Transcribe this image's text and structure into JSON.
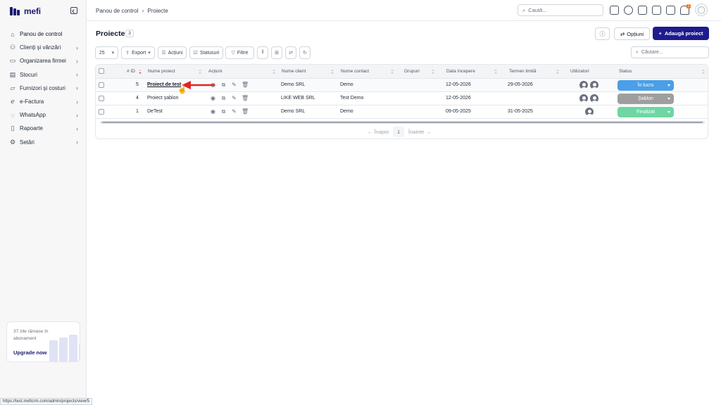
{
  "brand": {
    "name": "mefi"
  },
  "sidebar": {
    "items": [
      {
        "label": "Panou de control",
        "icon": "home-icon",
        "has_children": false
      },
      {
        "label": "Clienți și vânzări",
        "icon": "users-icon",
        "has_children": true
      },
      {
        "label": "Organizarea firmei",
        "icon": "briefcase-icon",
        "has_children": true
      },
      {
        "label": "Stocuri",
        "icon": "archive-icon",
        "has_children": true
      },
      {
        "label": "Furnizori și costuri",
        "icon": "folder-icon",
        "has_children": true
      },
      {
        "label": "e-Factura",
        "icon": "efactura-icon",
        "has_children": true
      },
      {
        "label": "WhatsApp",
        "icon": "chat-icon",
        "has_children": true
      },
      {
        "label": "Rapoarte",
        "icon": "clipboard-icon",
        "has_children": true
      },
      {
        "label": "Setări",
        "icon": "gear-icon",
        "has_children": true
      }
    ],
    "upgrade": {
      "text": "37 zile rămase în abonament",
      "cta": "Upgrade now"
    }
  },
  "topbar": {
    "breadcrumb": [
      "Panou de control",
      "Proiecte"
    ],
    "search_placeholder": "Caută...",
    "notification_count": "1"
  },
  "page": {
    "title": "Proiecte",
    "count": "3",
    "options_label": "Opțiuni",
    "add_label": "Adaugă proiect"
  },
  "toolbar": {
    "page_size": "25",
    "export_label": "Export",
    "actions_label": "Acțiuni",
    "statuses_label": "Statusuri",
    "filters_label": "Filtre",
    "search_placeholder": "Căutare..."
  },
  "table": {
    "columns": [
      "# ID",
      "Nume proiect",
      "Acțiuni",
      "Nume client",
      "Nume contact",
      "Grupuri",
      "Data începere",
      "Termen limită",
      "Utilizatori",
      "Status"
    ],
    "rows": [
      {
        "id": "5",
        "name": "Proiect de test",
        "client": "Demo SRL",
        "contact": "Demo",
        "groups": "",
        "start": "12-05-2026",
        "deadline": "29-05-2026",
        "users": 2,
        "status": "În lucru",
        "status_color": "#4a9fe8"
      },
      {
        "id": "4",
        "name": "Proiect șablon",
        "client": "LIKE WEB SRL",
        "contact": "Test Demo",
        "groups": "",
        "start": "12-05-2026",
        "deadline": "",
        "users": 2,
        "status": "Șablon",
        "status_color": "#9e9e9e"
      },
      {
        "id": "1",
        "name": "DeTest",
        "client": "Demo SRL",
        "contact": "Demo",
        "groups": "",
        "start": "09-05-2025",
        "deadline": "31-05-2025",
        "users": 1,
        "status": "Finalizat",
        "status_color": "#6fd6a3"
      }
    ],
    "pagination": {
      "prev": "← Înapoi",
      "current": "1",
      "next": "Înainte →"
    }
  },
  "browser_status_url": "https://test.meficrm.com/admin/projects/view/5",
  "colors": {
    "primary": "#1e1b8f",
    "annotation_arrow": "#e02424"
  }
}
